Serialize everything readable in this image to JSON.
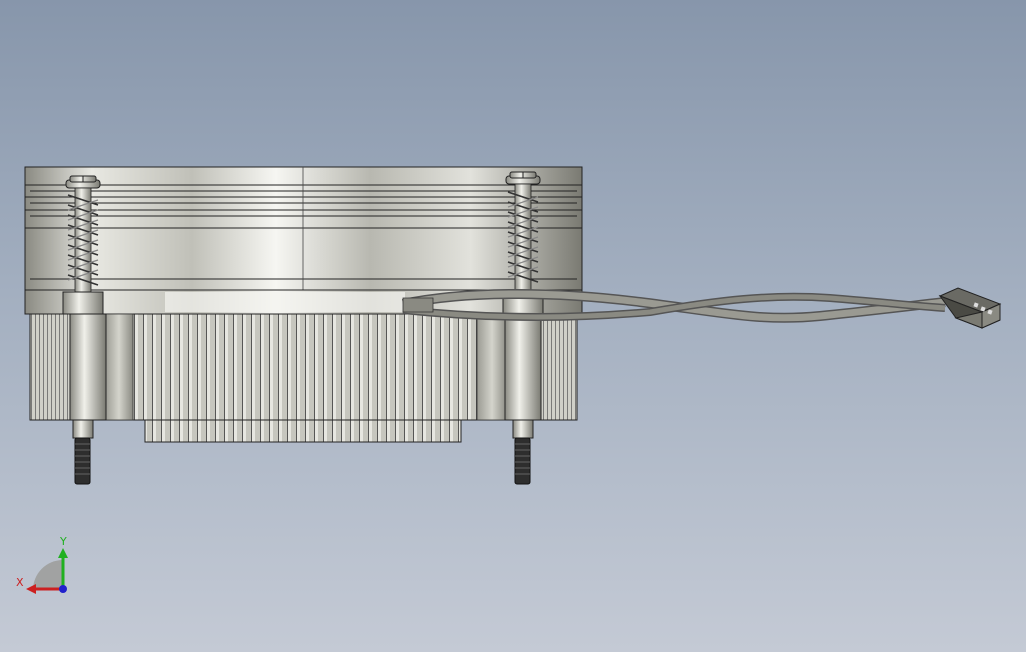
{
  "viewport": {
    "background_top": "#8796ab",
    "background_bottom": "#c4cad5"
  },
  "model": {
    "body_color": "#d8d8d0",
    "fin_color": "#c8c8c0",
    "cable_color": "#808078",
    "screw_color": "#303030"
  },
  "triad": {
    "x_label": "X",
    "y_label": "Y",
    "x_color": "#cc2020",
    "y_color": "#20b020",
    "z_color": "#2020cc"
  }
}
